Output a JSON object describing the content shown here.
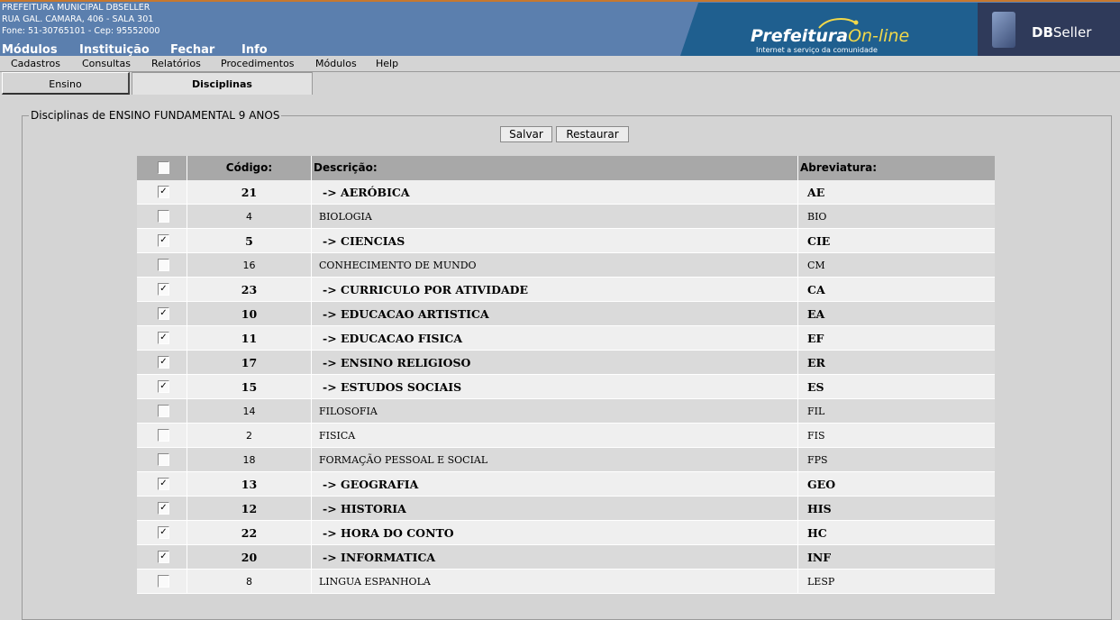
{
  "header": {
    "org_name": "PREFEITURA MUNICIPAL DBSELLER",
    "address": "RUA GAL. CAMARA, 406 - SALA 301",
    "contact": "Fone: 51-30765101  -  Cep: 95552000",
    "menu": [
      "Módulos",
      "Instituição",
      "Fechar",
      "Info"
    ],
    "banner_brand": "Prefeitura",
    "banner_brand_suffix": "On-line",
    "banner_tagline": "Internet a serviço da comunidade",
    "vendor_logo_bold": "DB",
    "vendor_logo_rest": "Seller"
  },
  "menubar": [
    "Cadastros",
    "Consultas",
    "Relatórios",
    "Procedimentos",
    "Módulos",
    "Help"
  ],
  "tabs": [
    "Ensino",
    "Disciplinas"
  ],
  "form": {
    "legend": "Disciplinas de ENSINO FUNDAMENTAL 9 ANOS",
    "save_label": "Salvar",
    "restore_label": "Restaurar"
  },
  "table": {
    "columns": [
      "Código:",
      "Descrição:",
      "Abreviatura:"
    ],
    "rows": [
      {
        "checked": true,
        "code": "21",
        "desc": "-> AERÓBICA",
        "abbr": "AE"
      },
      {
        "checked": false,
        "code": "4",
        "desc": "BIOLOGIA",
        "abbr": "BIO"
      },
      {
        "checked": true,
        "code": "5",
        "desc": "-> CIENCIAS",
        "abbr": "CIE"
      },
      {
        "checked": false,
        "code": "16",
        "desc": "CONHECIMENTO DE MUNDO",
        "abbr": "CM"
      },
      {
        "checked": true,
        "code": "23",
        "desc": "-> CURRICULO POR ATIVIDADE",
        "abbr": "CA"
      },
      {
        "checked": true,
        "code": "10",
        "desc": "-> EDUCACAO ARTISTICA",
        "abbr": "EA"
      },
      {
        "checked": true,
        "code": "11",
        "desc": "-> EDUCACAO FISICA",
        "abbr": "EF"
      },
      {
        "checked": true,
        "code": "17",
        "desc": "-> ENSINO RELIGIOSO",
        "abbr": "ER"
      },
      {
        "checked": true,
        "code": "15",
        "desc": "-> ESTUDOS SOCIAIS",
        "abbr": "ES"
      },
      {
        "checked": false,
        "code": "14",
        "desc": "FILOSOFIA",
        "abbr": "FIL"
      },
      {
        "checked": false,
        "code": "2",
        "desc": "FISICA",
        "abbr": "FIS"
      },
      {
        "checked": false,
        "code": "18",
        "desc": "FORMAÇÃO PESSOAL E SOCIAL",
        "abbr": "FPS"
      },
      {
        "checked": true,
        "code": "13",
        "desc": "-> GEOGRAFIA",
        "abbr": "GEO"
      },
      {
        "checked": true,
        "code": "12",
        "desc": "-> HISTORIA",
        "abbr": "HIS"
      },
      {
        "checked": true,
        "code": "22",
        "desc": "-> HORA DO CONTO",
        "abbr": "HC"
      },
      {
        "checked": true,
        "code": "20",
        "desc": "-> INFORMATICA",
        "abbr": "INF"
      },
      {
        "checked": false,
        "code": "8",
        "desc": "LINGUA ESPANHOLA",
        "abbr": "LESP"
      }
    ]
  },
  "colors": {
    "header_bg": "#5b7fae",
    "table_header_bg": "#a8a8a8",
    "row_light": "#efefef",
    "row_dark": "#dadada"
  }
}
